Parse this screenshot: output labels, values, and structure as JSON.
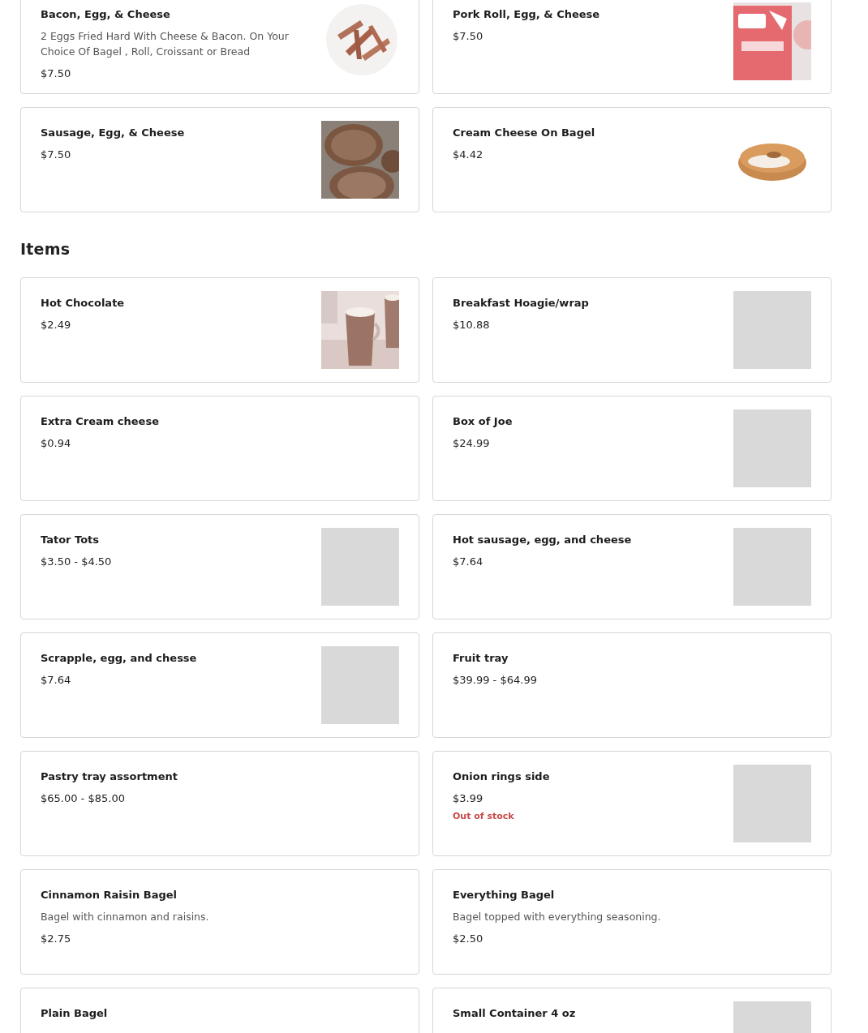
{
  "sections": [
    {
      "items": [
        {
          "name": "Bacon, Egg, & Cheese",
          "description": "2 Eggs Fried Hard With Cheese & Bacon. On Your Choice Of Bagel , Roll, Croissant or Bread",
          "price": "$7.50"
        },
        {
          "name": "Pork Roll, Egg, & Cheese",
          "price": "$7.50"
        },
        {
          "name": "Sausage, Egg, & Cheese",
          "price": "$7.50"
        },
        {
          "name": "Cream Cheese On Bagel",
          "price": "$4.42"
        }
      ]
    },
    {
      "title": "Items",
      "items": [
        {
          "name": "Hot Chocolate",
          "price": "$2.49"
        },
        {
          "name": "Breakfast Hoagie/wrap",
          "price": "$10.88",
          "image": {
            "kind": "placeholder"
          }
        },
        {
          "name": "Extra Cream cheese",
          "price": "$0.94"
        },
        {
          "name": "Box of Joe",
          "price": "$24.99",
          "image": {
            "kind": "placeholder"
          }
        },
        {
          "name": "Tator Tots",
          "price": "$3.50 - $4.50",
          "image": {
            "kind": "placeholder"
          }
        },
        {
          "name": "Hot sausage, egg, and cheese",
          "price": "$7.64",
          "image": {
            "kind": "placeholder"
          }
        },
        {
          "name": "Scrapple, egg, and chesse",
          "price": "$7.64",
          "image": {
            "kind": "placeholder"
          }
        },
        {
          "name": "Fruit tray",
          "price": "$39.99 - $64.99"
        },
        {
          "name": "Pastry tray assortment",
          "price": "$65.00 - $85.00"
        },
        {
          "name": "Onion rings side",
          "price": "$3.99",
          "stock_note": "Out of stock",
          "image": {
            "kind": "placeholder"
          }
        },
        {
          "name": "Cinnamon Raisin Bagel",
          "description": "Bagel with cinnamon and raisins.",
          "price": "$2.75"
        },
        {
          "name": "Everything Bagel",
          "description": "Bagel topped with everything seasoning.",
          "price": "$2.50"
        },
        {
          "name": "Plain Bagel"
        },
        {
          "name": "Small Container 4 oz",
          "image": {
            "kind": "placeholder"
          }
        }
      ]
    }
  ]
}
